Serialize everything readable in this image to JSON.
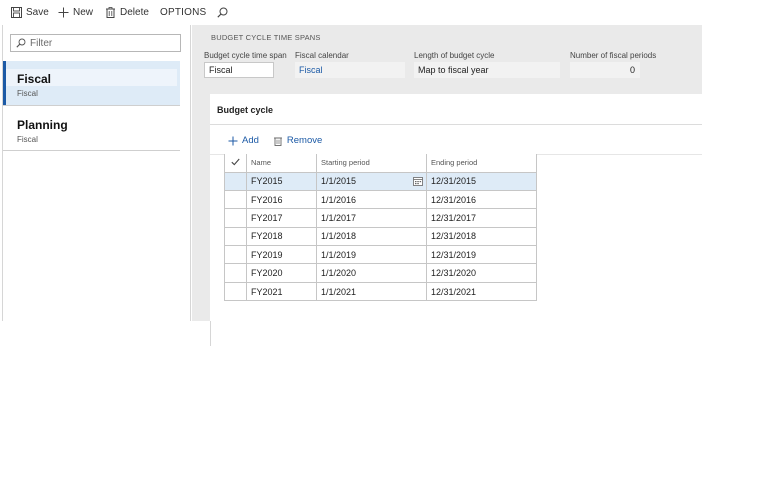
{
  "toolbar": {
    "save_label": "Save",
    "new_label": "New",
    "delete_label": "Delete",
    "options_label": "OPTIONS"
  },
  "filter": {
    "placeholder": "Filter"
  },
  "list": {
    "items": [
      {
        "title": "Fiscal",
        "subtitle": "Fiscal",
        "selected": true
      },
      {
        "title": "Planning",
        "subtitle": "Fiscal",
        "selected": false
      }
    ]
  },
  "details": {
    "section_heading": "BUDGET CYCLE TIME SPANS",
    "fields": {
      "time_span": {
        "label": "Budget cycle time span",
        "value": "Fiscal"
      },
      "calendar": {
        "label": "Fiscal calendar",
        "value": "Fiscal"
      },
      "length": {
        "label": "Length of budget cycle",
        "value": "Map to fiscal year"
      },
      "periods": {
        "label": "Number of fiscal periods",
        "value": "0"
      }
    }
  },
  "budget_cycle": {
    "title": "Budget cycle",
    "add_label": "Add",
    "remove_label": "Remove",
    "columns": {
      "name": "Name",
      "start": "Starting period",
      "end": "Ending period"
    },
    "rows": [
      {
        "name": "FY2015",
        "start": "1/1/2015",
        "end": "12/31/2015",
        "selected": true
      },
      {
        "name": "FY2016",
        "start": "1/1/2016",
        "end": "12/31/2016"
      },
      {
        "name": "FY2017",
        "start": "1/1/2017",
        "end": "12/31/2017"
      },
      {
        "name": "FY2018",
        "start": "1/1/2018",
        "end": "12/31/2018"
      },
      {
        "name": "FY2019",
        "start": "1/1/2019",
        "end": "12/31/2019"
      },
      {
        "name": "FY2020",
        "start": "1/1/2020",
        "end": "12/31/2020"
      },
      {
        "name": "FY2021",
        "start": "1/1/2021",
        "end": "12/31/2021"
      }
    ]
  },
  "colors": {
    "accent": "#1c5aa6",
    "selection": "#deebf7",
    "pane_background": "#eaeaea"
  },
  "icons": {
    "save": "save-icon",
    "new": "plus-icon",
    "delete": "trash-icon",
    "search": "search-icon",
    "filter": "search-icon",
    "calendar": "calendar-icon",
    "check": "checkmark-icon"
  }
}
